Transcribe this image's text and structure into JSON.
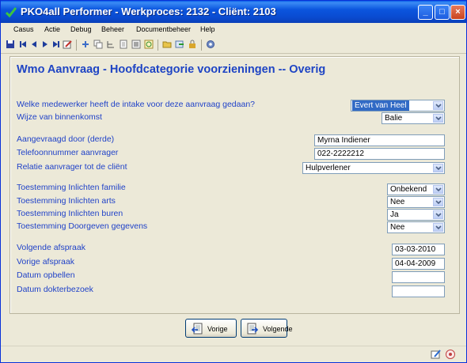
{
  "window": {
    "title": "PKO4all Performer - Werkproces: 2132 - Cliënt: 2103",
    "minimize_glyph": "_",
    "maximize_glyph": "□",
    "close_glyph": "×"
  },
  "menu": [
    "Casus",
    "Actie",
    "Debug",
    "Beheer",
    "Documentbeheer",
    "Help"
  ],
  "toolbar_icons": [
    "save-icon",
    "first-record-icon",
    "previous-record-icon",
    "next-record-icon",
    "last-record-icon",
    "edit-icon",
    "add-icon",
    "copy-icon",
    "tree-icon",
    "document-icon",
    "list-icon",
    "refresh-icon",
    "folder-icon",
    "export-icon",
    "lock-icon",
    "settings-icon"
  ],
  "form": {
    "heading": "Wmo Aanvraag - Hoofdcategorie voorzieningen -- Overig",
    "intake_label": "Welke medewerker heeft de intake voor deze aanvraag gedaan?",
    "intake_value": "Evert van Heel",
    "binnenkomst_label": "Wijze van binnenkomst",
    "binnenkomst_value": "Balie",
    "aangevraagd_label": "Aangevraagd door (derde)",
    "aangevraagd_value": "Myrna Indiener",
    "telefoon_label": "Telefoonnummer aanvrager",
    "telefoon_value": "022-2222212",
    "relatie_label": "Relatie aanvrager tot de cliënt",
    "relatie_value": "Hulpverlener",
    "familie_label": "Toestemming Inlichten familie",
    "familie_value": "Onbekend",
    "arts_label": "Toestemming Inlichten arts",
    "arts_value": "Nee",
    "buren_label": "Toestemming Inlichten buren",
    "buren_value": "Ja",
    "doorgeven_label": "Toestemming Doorgeven gegevens",
    "doorgeven_value": "Nee",
    "volgende_label": "Volgende afspraak",
    "volgende_value": "03-03-2010",
    "vorige_label": "Vorige afspraak",
    "vorige_value": "04-04-2009",
    "opbellen_label": "Datum opbellen",
    "opbellen_value": "",
    "dokter_label": "Datum dokterbezoek",
    "dokter_value": ""
  },
  "buttons": {
    "prev_label": "Vorige",
    "next_label": "Volgende"
  },
  "colors": {
    "title_bar": "#0a4bd0",
    "label_blue": "#2042c8",
    "selection": "#316ac5"
  }
}
